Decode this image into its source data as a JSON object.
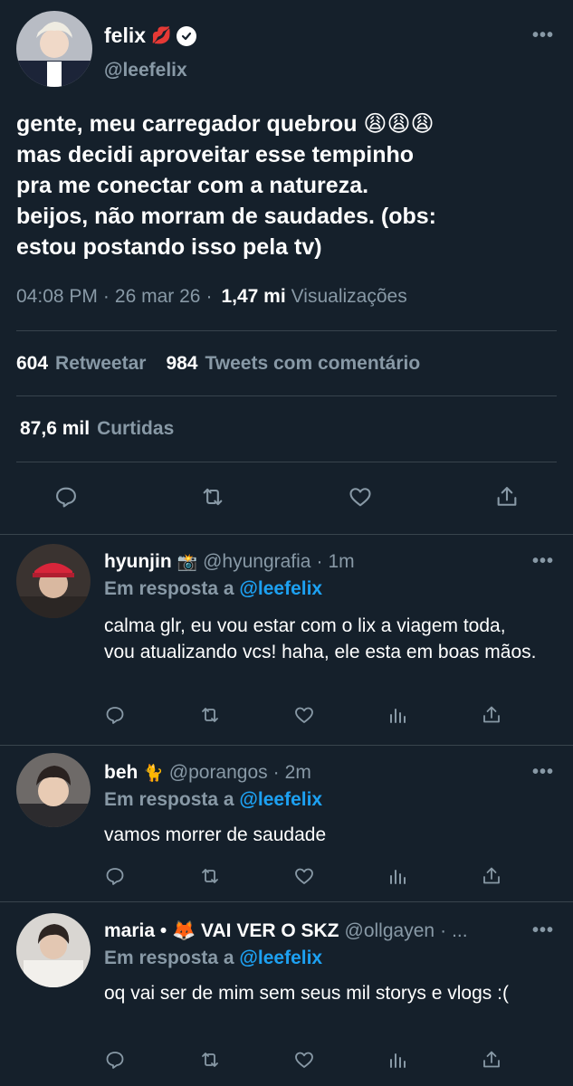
{
  "main_tweet": {
    "name": "felix",
    "name_emoji": "💋",
    "handle": "@leefelix",
    "text_lines": [
      "gente, meu carregador quebrou 😩😩😩",
      "mas decidi aproveitar esse tempinho",
      "pra me conectar com a natureza.",
      "beijos, não morram de saudades. (obs:",
      "estou postando isso pela tv)"
    ],
    "time": "04:08 PM",
    "date": "26 mar 26",
    "views_count": "1,47 mi",
    "views_label": "Visualizações",
    "retweets_count": "604",
    "retweets_label": "Retweetar",
    "quotes_count": "984",
    "quotes_label": "Tweets com comentário",
    "likes_count": "87,6 mil",
    "likes_label": "Curtidas",
    "more": "•••"
  },
  "replies": [
    {
      "name": "hyunjin",
      "name_emoji": "📸",
      "handle": "@hyungrafia",
      "time": "1m",
      "reply_to_label": "Em resposta a",
      "reply_to_mention": "@leefelix",
      "text": "calma glr, eu vou estar com o lix a viagem toda, vou atualizando vcs! haha, ele esta em boas mãos.",
      "more": "•••"
    },
    {
      "name": "beh",
      "name_emoji": "🐈",
      "handle": "@porangos",
      "time": "2m",
      "reply_to_label": "Em resposta a",
      "reply_to_mention": "@leefelix",
      "text": "vamos morrer de saudade",
      "more": "•••"
    },
    {
      "name": "maria • 🦊 VAI VER O SKZ",
      "name_emoji": "",
      "handle": "@ollgayen",
      "time": "...",
      "reply_to_label": "Em resposta a",
      "reply_to_mention": "@leefelix",
      "text": "oq vai ser de mim sem seus mil storys e vlogs :(",
      "more": "•••"
    }
  ],
  "colors": {
    "background": "#15202b",
    "secondary_text": "#8899a6",
    "divider": "#38444d",
    "mention": "#1da1f2"
  },
  "icons": [
    "reply-icon",
    "retweet-icon",
    "like-icon",
    "share-icon",
    "analytics-icon",
    "verified-icon"
  ]
}
